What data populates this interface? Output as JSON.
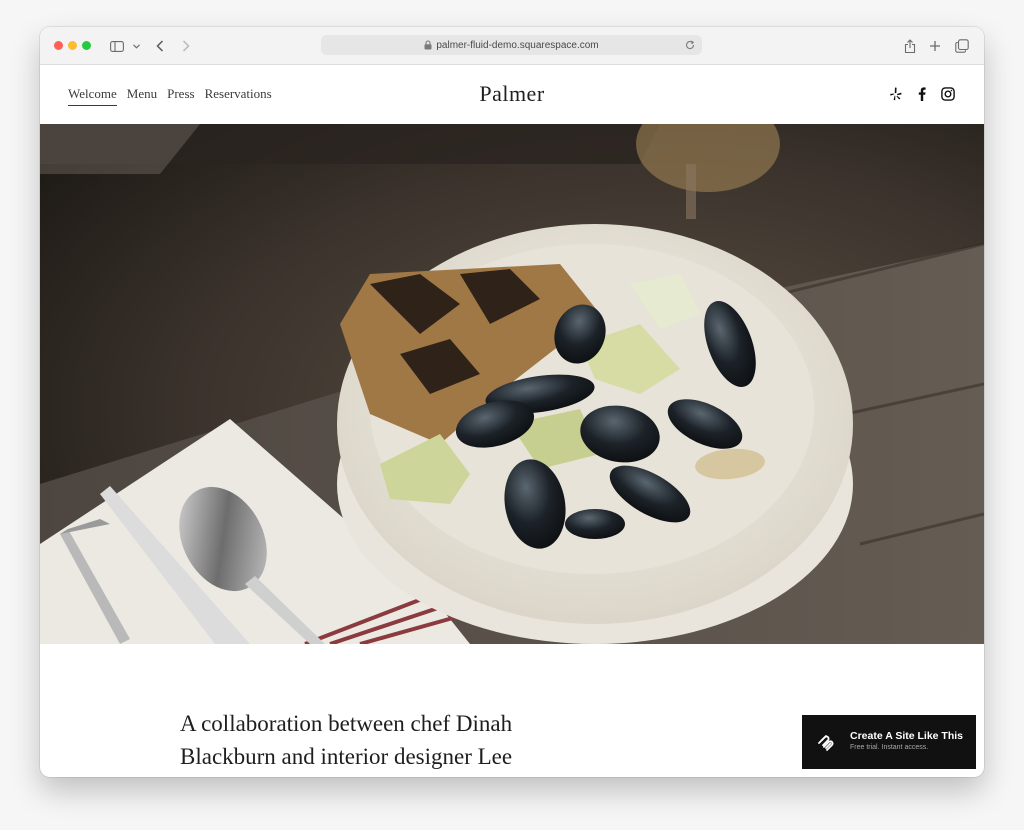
{
  "browser": {
    "url": "palmer-fluid-demo.squarespace.com"
  },
  "site": {
    "logo": "Palmer",
    "nav": [
      {
        "label": "Welcome",
        "active": true
      },
      {
        "label": "Menu",
        "active": false
      },
      {
        "label": "Press",
        "active": false
      },
      {
        "label": "Reservations",
        "active": false
      }
    ],
    "social_icons": [
      "yelp-icon",
      "facebook-icon",
      "instagram-icon"
    ]
  },
  "hero": {
    "image": "mussels-bowl-with-grilled-bread"
  },
  "intro": {
    "line1": "A collaboration between chef Dinah",
    "line2": "Blackburn and interior designer Lee"
  },
  "badge": {
    "title": "Create A Site Like This",
    "subtitle": "Free trial. Instant access."
  },
  "colors": {
    "badge_bg": "#111111",
    "traffic_red": "#ff5f57",
    "traffic_yellow": "#febc2e",
    "traffic_green": "#28c840"
  }
}
